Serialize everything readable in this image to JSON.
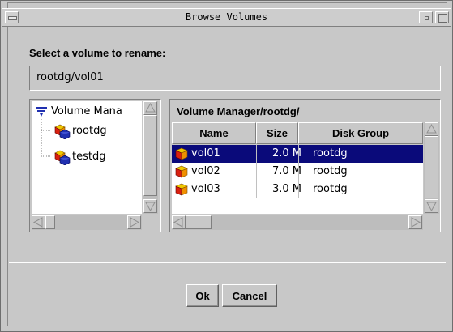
{
  "window": {
    "title": "Browse Volumes"
  },
  "prompt": "Select a volume to rename:",
  "selection_value": "rootdg/vol01",
  "tree": {
    "root_label": "Volume Mana",
    "items": [
      {
        "label": "rootdg"
      },
      {
        "label": "testdg"
      }
    ]
  },
  "table": {
    "heading": "Volume Manager/rootdg/",
    "columns": [
      "Name",
      "Size",
      "Disk Group"
    ],
    "rows": [
      {
        "name": "vol01",
        "size": "2.0 M",
        "group": "rootdg",
        "selected": true
      },
      {
        "name": "vol02",
        "size": "7.0 M",
        "group": "rootdg",
        "selected": false
      },
      {
        "name": "vol03",
        "size": "3.0 M",
        "group": "rootdg",
        "selected": false
      }
    ]
  },
  "buttons": {
    "ok": "Ok",
    "cancel": "Cancel"
  },
  "icons": {
    "tree_root": "volume-manager-icon",
    "disk_group": "disk-group-icon",
    "volume": "volume-icon"
  },
  "colors": {
    "selection": "#0a0a7a",
    "window_bg": "#c8c8c8",
    "cube_red": "#d82010",
    "cube_yellow": "#f0c800",
    "cube_blue": "#2030b0"
  }
}
